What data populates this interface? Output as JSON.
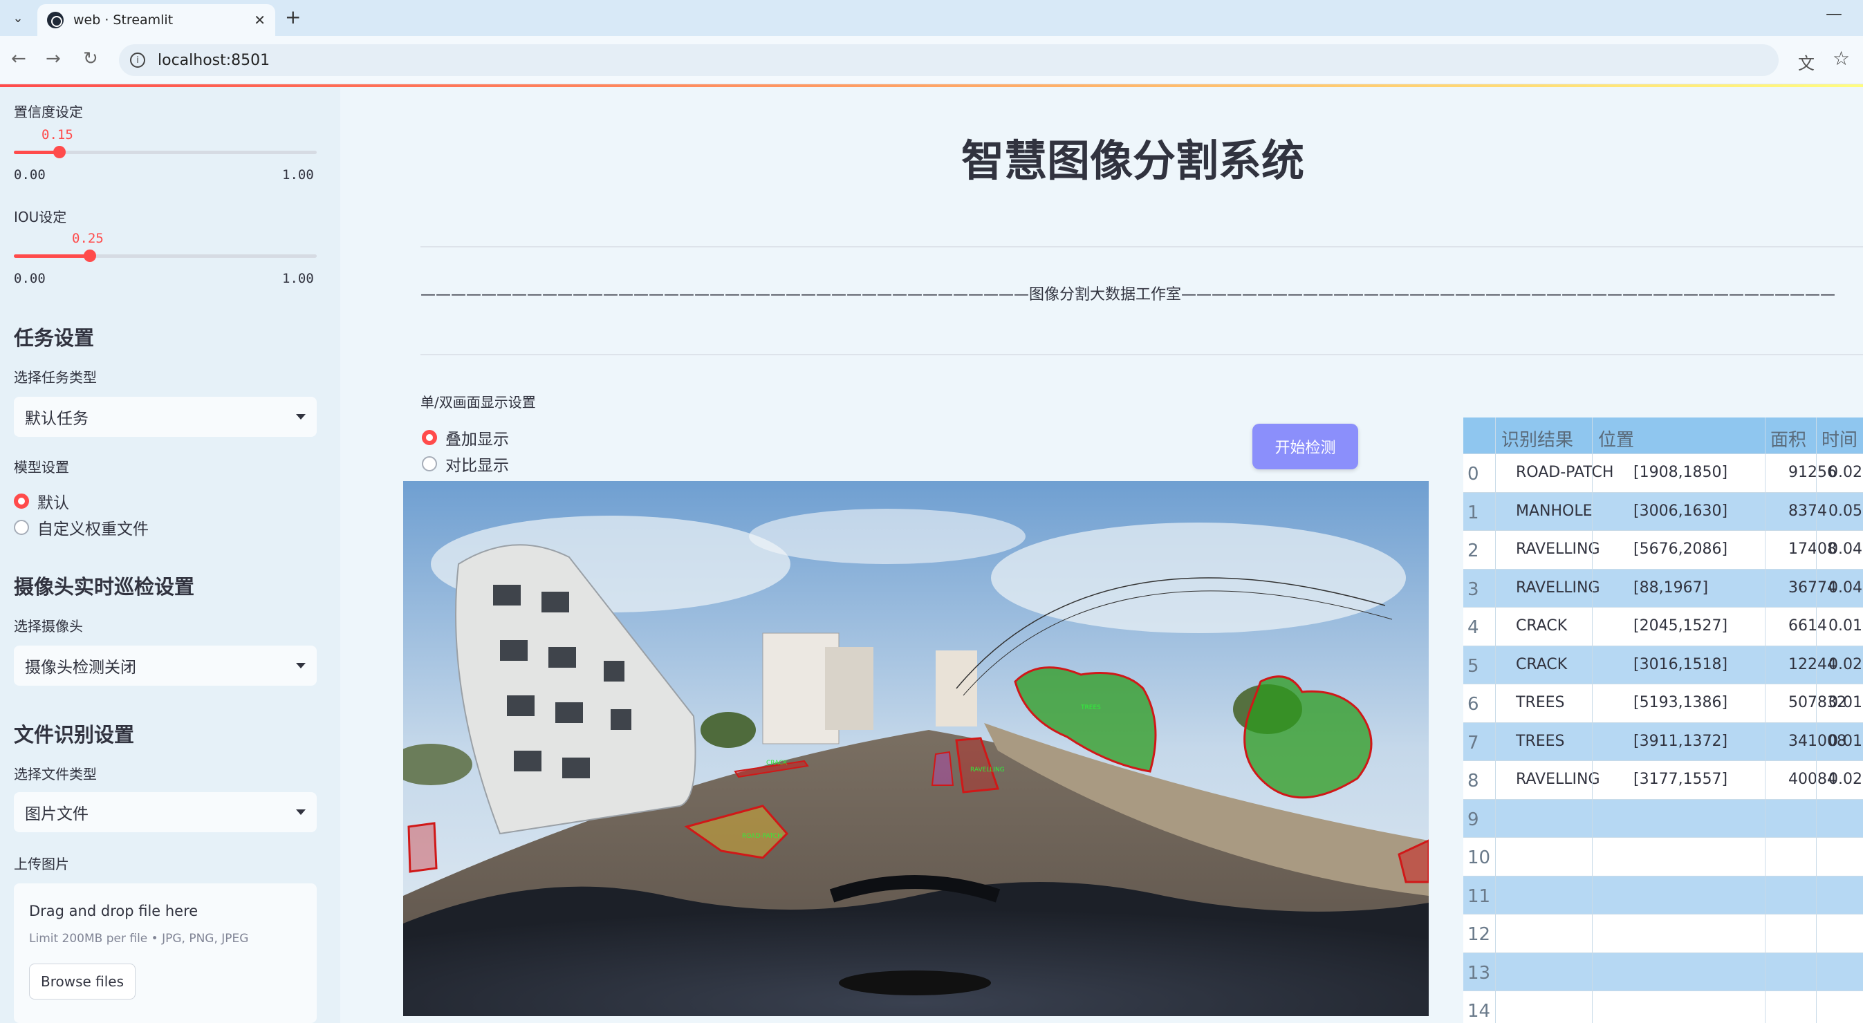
{
  "browser": {
    "tab_title": "web · Streamlit",
    "url": "localhost:8501"
  },
  "sidebar": {
    "confidence": {
      "label": "置信度设定",
      "value": "0.15",
      "value_num": 0.15,
      "min": "0.00",
      "max": "1.00"
    },
    "iou": {
      "label": "IOU设定",
      "value": "0.25",
      "value_num": 0.25,
      "min": "0.00",
      "max": "1.00"
    },
    "task_header": "任务设置",
    "task_select_label": "选择任务类型",
    "task_select_value": "默认任务",
    "model_label": "模型设置",
    "model_options": [
      "默认",
      "自定义权重文件"
    ],
    "camera_header": "摄像头实时巡检设置",
    "camera_select_label": "选择摄像头",
    "camera_select_value": "摄像头检测关闭",
    "file_header": "文件识别设置",
    "file_type_label": "选择文件类型",
    "file_type_value": "图片文件",
    "upload_label": "上传图片",
    "dropzone_title": "Drag and drop file here",
    "dropzone_sub": "Limit 200MB per file • JPG, PNG, JPEG",
    "browse_label": "Browse files"
  },
  "main": {
    "title": "智慧图像分割系统",
    "studio_line": "————————————————————————————————————————图像分割大数据工作室———————————————————————————————————————————",
    "display_label": "单/双画面显示设置",
    "display_options": [
      "叠加显示",
      "对比显示"
    ],
    "start_button": "开始检测"
  },
  "table": {
    "headers": [
      "识别结果",
      "位置",
      "面积",
      "时间"
    ],
    "rows": [
      [
        "0",
        "ROAD-PATCH",
        "[1908,1850]",
        "91256",
        "0.02"
      ],
      [
        "1",
        "MANHOLE",
        "[3006,1630]",
        "8374",
        "0.05"
      ],
      [
        "2",
        "RAVELLING",
        "[5676,2086]",
        "17408",
        "0.04"
      ],
      [
        "3",
        "RAVELLING",
        "[88,1967]",
        "36774",
        "0.04"
      ],
      [
        "4",
        "CRACK",
        "[2045,1527]",
        "6614",
        "0.01"
      ],
      [
        "5",
        "CRACK",
        "[3016,1518]",
        "12244",
        "0.02"
      ],
      [
        "6",
        "TREES",
        "[5193,1386]",
        "507832",
        "0.01"
      ],
      [
        "7",
        "TREES",
        "[3911,1372]",
        "341008",
        "0.01"
      ],
      [
        "8",
        "RAVELLING",
        "[3177,1557]",
        "40084",
        "0.02"
      ],
      [
        "9",
        "",
        "",
        "",
        ""
      ],
      [
        "10",
        "",
        "",
        "",
        ""
      ],
      [
        "11",
        "",
        "",
        "",
        ""
      ],
      [
        "12",
        "",
        "",
        "",
        ""
      ],
      [
        "13",
        "",
        "",
        "",
        ""
      ],
      [
        "14",
        "",
        "",
        "",
        ""
      ]
    ]
  },
  "image_labels": [
    "ROAD-PATCH",
    "CRACK",
    "RAVELLING",
    "TREES"
  ],
  "colors": {
    "accent": "#ff4b4b",
    "button": "#8b8ffb",
    "mask_green": "#2e9b1f",
    "mask_red": "#d01818"
  }
}
